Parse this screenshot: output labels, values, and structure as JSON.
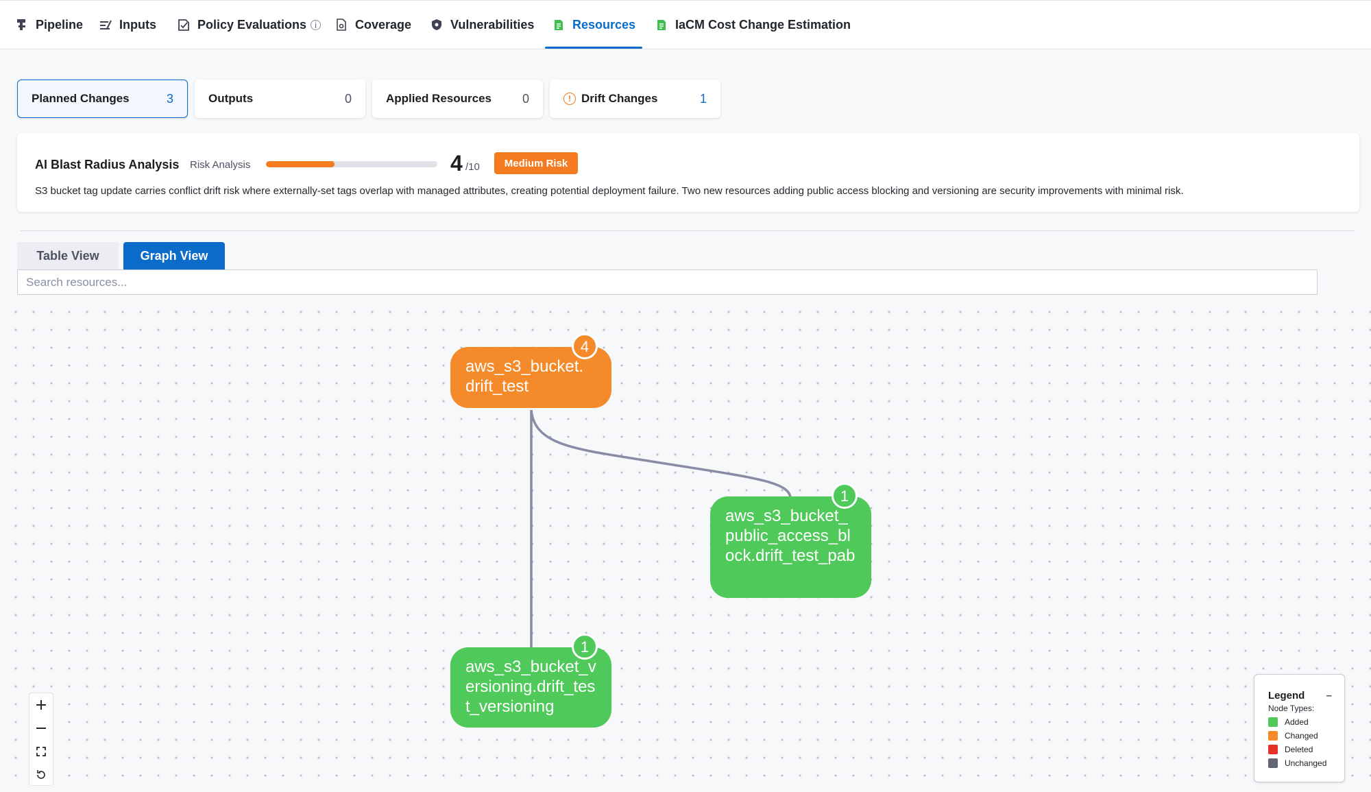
{
  "nav": {
    "tabs": [
      {
        "label": "Pipeline",
        "icon": "pipeline-icon"
      },
      {
        "label": "Inputs",
        "icon": "inputs-icon"
      },
      {
        "label": "Policy Evaluations",
        "icon": "policy-icon"
      },
      {
        "label": "Coverage",
        "icon": "coverage-icon"
      },
      {
        "label": "Vulnerabilities",
        "icon": "shield-icon"
      },
      {
        "label": "Resources",
        "icon": "resources-icon",
        "active": true
      },
      {
        "label": "IaCM Cost Change Estimation",
        "icon": "cost-icon"
      }
    ]
  },
  "stats": [
    {
      "label": "Planned Changes",
      "count": "3",
      "selected": true
    },
    {
      "label": "Outputs",
      "count": "0"
    },
    {
      "label": "Applied Resources",
      "count": "0"
    },
    {
      "label": "Drift Changes",
      "count": "1"
    }
  ],
  "blast": {
    "title": "AI Blast Radius Analysis",
    "risk_label": "Risk Analysis",
    "score": "4",
    "max": "/10",
    "score_fraction": 0.4,
    "badge": "Medium Risk",
    "description": "S3 bucket tag update carries conflict drift risk where externally-set tags overlap with managed attributes, creating potential deployment failure. Two new resources adding public access blocking and versioning are security improvements with minimal risk."
  },
  "views": {
    "table": "Table View",
    "graph": "Graph View",
    "active": "graph"
  },
  "search": {
    "placeholder": "Search resources...",
    "value": ""
  },
  "graph": {
    "nodes": [
      {
        "id": "n1",
        "label": "aws_s3_bucket.\ndrift_test",
        "type": "changed",
        "count": "4"
      },
      {
        "id": "n2",
        "label": "aws_s3_bucket_public_access_block.drift_test_pab",
        "type": "added",
        "count": "1"
      },
      {
        "id": "n3",
        "label": "aws_s3_bucket_versioning.drift_test_versioning",
        "type": "added",
        "count": "1"
      }
    ]
  },
  "legend": {
    "title": "Legend",
    "collapse": "–",
    "subtitle": "Node Types:",
    "items": [
      {
        "label": "Added",
        "color": "#4fc95a"
      },
      {
        "label": "Changed",
        "color": "#f58a2a"
      },
      {
        "label": "Deleted",
        "color": "#e5332a"
      },
      {
        "label": "Unchanged",
        "color": "#636675"
      }
    ]
  },
  "colors": {
    "accent": "#0a6bc9",
    "changed": "#f58a2a",
    "added": "#4fc95a",
    "risk": "#f57b20"
  }
}
